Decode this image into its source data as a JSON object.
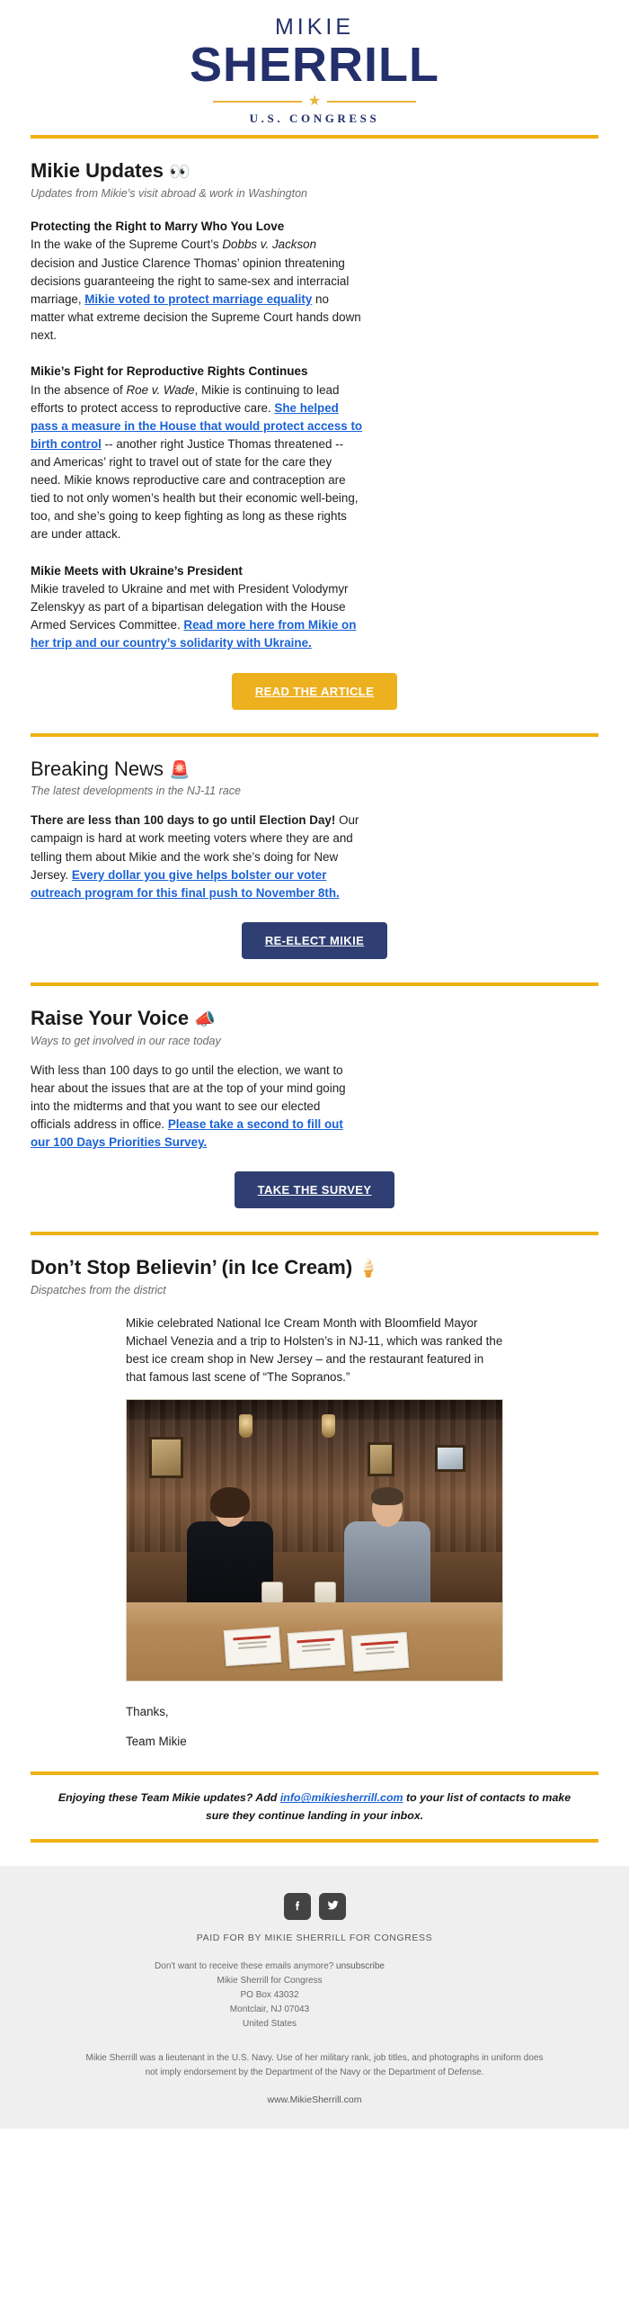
{
  "logo": {
    "first_name": "MIKIE",
    "last_name": "SHERRILL",
    "office": "U.S. CONGRESS",
    "star_icon": "star-icon",
    "navy": "#24306b",
    "gold": "#e8b33a"
  },
  "sections": [
    {
      "id": "mikie-updates",
      "title": "Mikie Updates",
      "emoji": "👀",
      "emoji_name": "eyes-emoji",
      "subtitle": "Updates from Mikie’s visit abroad & work in Washington",
      "bold_title": true,
      "items": [
        {
          "heading": "Protecting the Right to Marry Who You Love",
          "body_before": "In the wake of the Supreme Court’s ",
          "italic_1": "Dobbs v. Jackson",
          "body_mid": " decision and Justice Clarence Thomas’ opinion threatening decisions guaranteeing the right to same-sex and interracial marriage, ",
          "link": "Mikie voted to protect marriage equality",
          "body_after": " no matter what extreme decision the Supreme Court hands down next."
        },
        {
          "heading": "Mikie’s Fight for Reproductive Rights Continues",
          "body_before": "In the absence of ",
          "italic_1": "Roe v. Wade",
          "body_mid": ", Mikie is continuing to lead efforts to protect access to reproductive care. ",
          "link": "She helped pass a measure in the House that would protect access to birth control",
          "body_after": " -- another right Justice Thomas threatened -- and Americas’ right to travel out of state for the care they need. Mikie knows reproductive care and contraception are tied to not only women’s health but their economic well-being, too, and she’s going to keep fighting as long as these rights are under attack."
        },
        {
          "heading": "Mikie Meets with Ukraine’s President",
          "body_before": "Mikie traveled to Ukraine and met with President Volodymyr Zelenskyy as part of a bipartisan delegation with the House Armed Services Committee. ",
          "link": "Read more here from Mikie on her trip and our country’s solidarity with Ukraine.",
          "body_after": ""
        }
      ],
      "button": {
        "label": "READ THE ARTICLE",
        "style": "gold",
        "color": "#edb01f"
      }
    },
    {
      "id": "breaking-news",
      "title": "Breaking News",
      "emoji": "🚨",
      "emoji_name": "siren-emoji",
      "subtitle": "The latest developments in the NJ-11 race",
      "bold_title": false,
      "items": [
        {
          "heading": "",
          "bold_lead": "There are less than 100 days to go until Election Day!",
          "body_mid": " Our campaign is hard at work meeting voters where they are and telling them about Mikie and the work she’s doing for New Jersey. ",
          "link": "Every dollar you give helps bolster our voter outreach program for this final push to November 8th.",
          "body_after": ""
        }
      ],
      "button": {
        "label": "RE-ELECT MIKIE",
        "style": "navy",
        "color": "#2f3f73"
      }
    },
    {
      "id": "raise-your-voice",
      "title": "Raise Your Voice",
      "emoji": "📣",
      "emoji_name": "megaphone-emoji",
      "subtitle": "Ways to get involved in our race today",
      "bold_title": true,
      "items": [
        {
          "heading": "",
          "body_before": "With less than 100 days to go until the election, we want to hear about the issues that are at the top of your mind going into the midterms and that you want to see our elected officials address in office. ",
          "link": "Please take a second to fill out our 100 Days Priorities Survey.",
          "body_after": ""
        }
      ],
      "button": {
        "label": "TAKE THE SURVEY",
        "style": "navy",
        "color": "#2f3f73"
      }
    },
    {
      "id": "ice-cream",
      "title": "Don’t Stop Believin’ (in Ice Cream)",
      "emoji": "🍦",
      "emoji_name": "ice-cream-emoji",
      "subtitle": "Dispatches from the district",
      "bold_title": true,
      "paragraph": "Mikie celebrated National Ice Cream Month with Bloomfield Mayor Michael Venezia and a trip to Holsten’s in NJ-11, which was ranked the best ice cream shop in New Jersey – and the restaurant featured in that famous last scene of “The Sopranos.”",
      "photo_alt": "Mikie Sherrill and Bloomfield Mayor Michael Venezia seated in a wood-panelled booth at Holsten’s ice cream parlor",
      "signoff_1": "Thanks,",
      "signoff_2": "Team Mikie"
    }
  ],
  "enjoy_box": {
    "text_before": "Enjoying these Team Mikie updates? Add ",
    "email": "info@mikiesherrill.com",
    "text_after": " to your list of contacts to make sure they continue landing in your inbox."
  },
  "footer": {
    "social": [
      {
        "name": "facebook-icon",
        "label": "Facebook"
      },
      {
        "name": "twitter-icon",
        "label": "Twitter"
      }
    ],
    "paid_for": "PAID FOR BY MIKIE SHERRILL FOR CONGRESS",
    "unsubscribe_text": "Don't want to receive these emails anymore?",
    "unsubscribe_link": "unsubscribe",
    "address_lines": [
      "Mikie Sherrill for Congress",
      "PO Box 43032",
      "Montclair, NJ 07043",
      "United States"
    ],
    "disclaimer": "Mikie Sherrill was a lieutenant in the U.S. Navy. Use of her military rank, job titles, and photographs in uniform does not imply endorsement by the Department of the Navy or the Department of Defense.",
    "website": "www.MikieSherrill.com"
  }
}
